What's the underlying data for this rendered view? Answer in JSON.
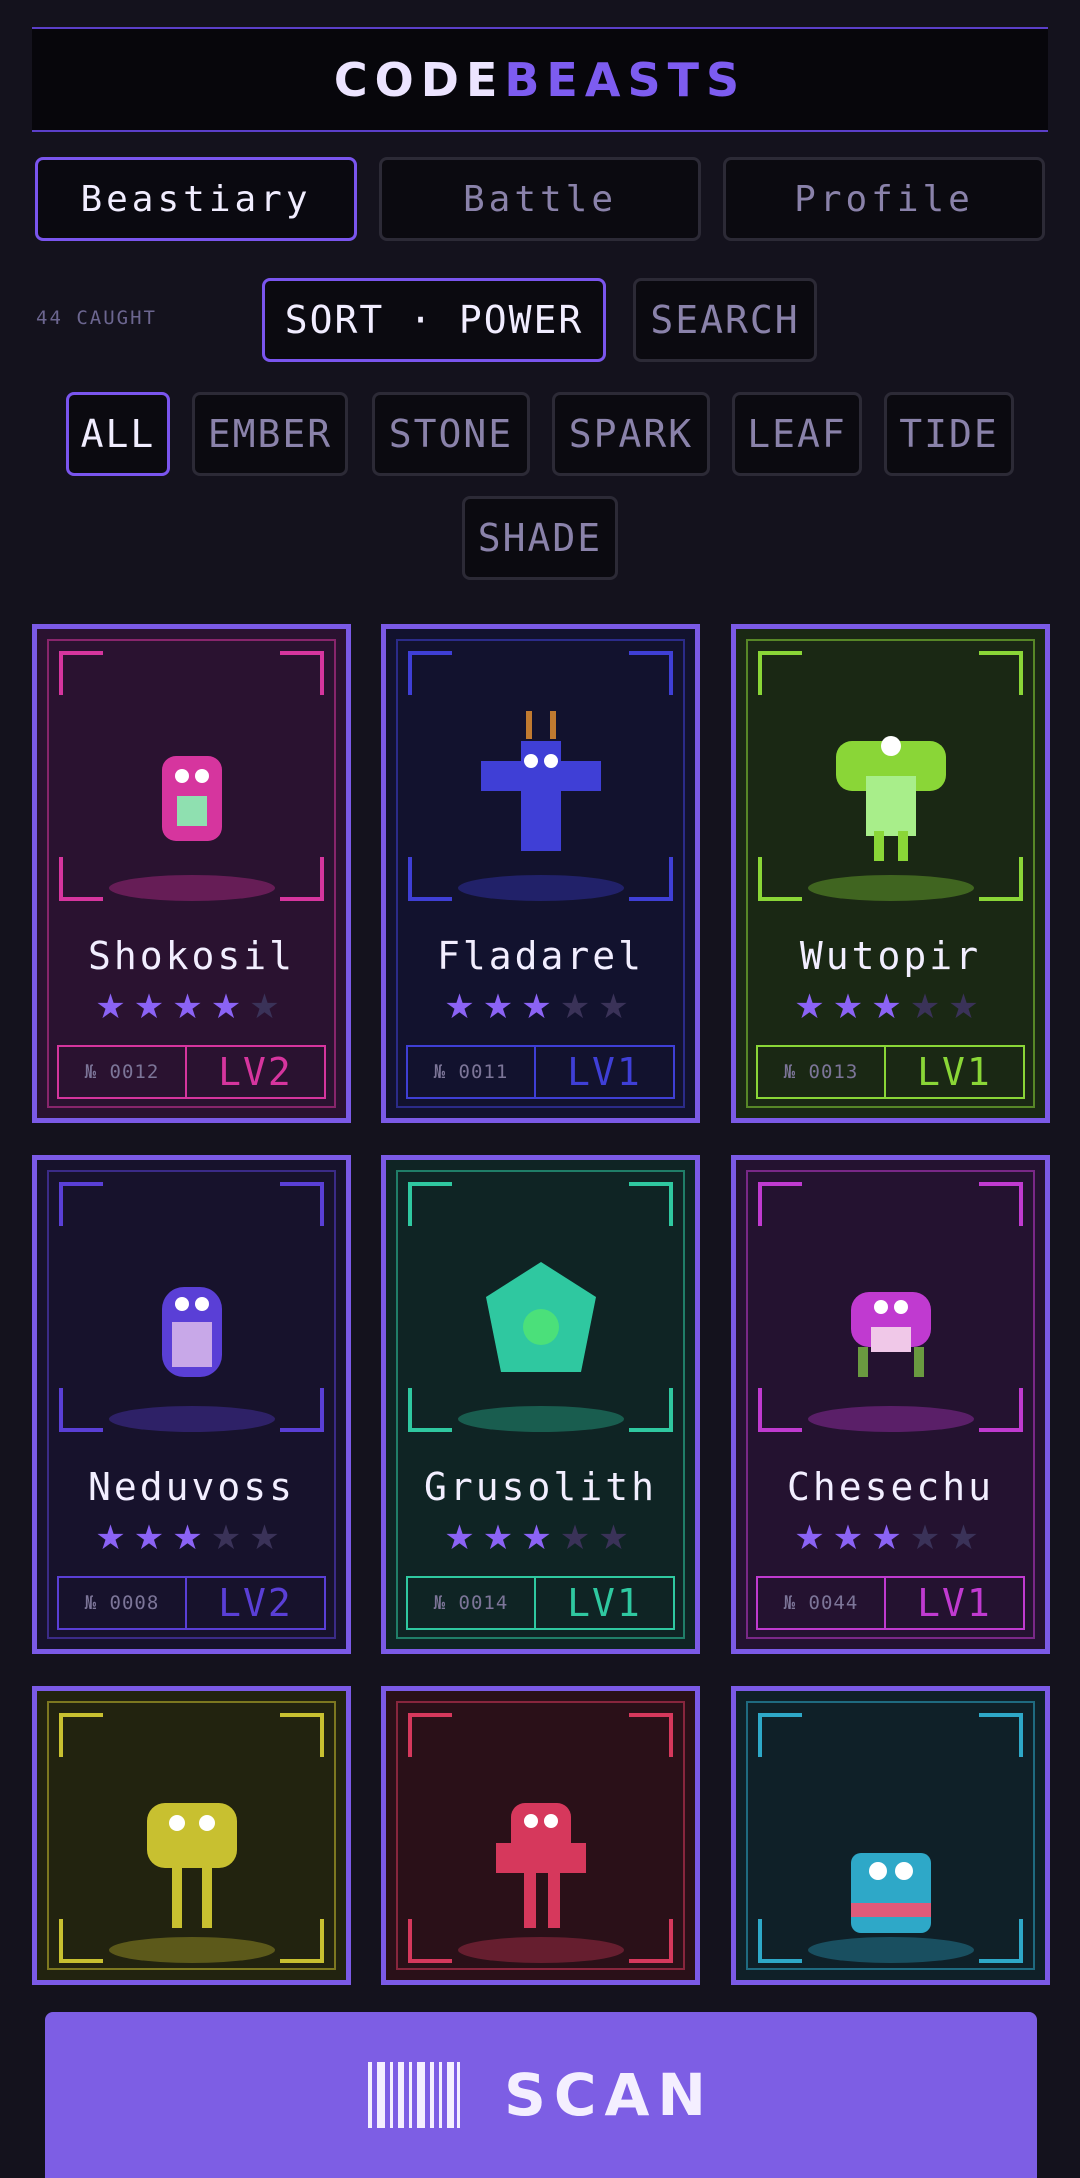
{
  "app": {
    "title_part1": "CODE",
    "title_part2": "BEASTS"
  },
  "tabs": [
    {
      "label": "Beastiary",
      "active": true
    },
    {
      "label": "Battle",
      "active": false
    },
    {
      "label": "Profile",
      "active": false
    }
  ],
  "toolbar": {
    "caught": "44 CAUGHT",
    "sort_label": "SORT · POWER",
    "search_label": "SEARCH"
  },
  "filters": [
    "ALL",
    "EMBER",
    "STONE",
    "SPARK",
    "LEAF",
    "TIDE",
    "SHADE"
  ],
  "active_filter": "ALL",
  "beasts": [
    {
      "name": "Shokosil",
      "number": "№ 0012",
      "level": "LV2",
      "stars": 4,
      "accent": "#d6359e",
      "bg": "#2a1230",
      "sprite": "pink-ghost-icon"
    },
    {
      "name": "Fladarel",
      "number": "№ 0011",
      "level": "LV1",
      "stars": 3,
      "accent": "#3f3fd6",
      "bg": "#12122e",
      "sprite": "blue-bug-icon"
    },
    {
      "name": "Wutopir",
      "number": "№ 0013",
      "level": "LV1",
      "stars": 3,
      "accent": "#8ad637",
      "bg": "#1a2814",
      "sprite": "green-plant-icon"
    },
    {
      "name": "Neduvoss",
      "number": "№ 0008",
      "level": "LV2",
      "stars": 3,
      "accent": "#5a3fd6",
      "bg": "#17122c",
      "sprite": "purple-blob-icon"
    },
    {
      "name": "Grusolith",
      "number": "№ 0014",
      "level": "LV1",
      "stars": 3,
      "accent": "#2fc8a0",
      "bg": "#0f2424",
      "sprite": "teal-rock-icon"
    },
    {
      "name": "Chesechu",
      "number": "№ 0044",
      "level": "LV1",
      "stars": 3,
      "accent": "#c03ad0",
      "bg": "#241230",
      "sprite": "magenta-crab-icon"
    },
    {
      "name": "",
      "number": "",
      "level": "",
      "stars": 0,
      "accent": "#c8c030",
      "bg": "#22230f",
      "sprite": "yellow-alien-icon"
    },
    {
      "name": "",
      "number": "",
      "level": "",
      "stars": 0,
      "accent": "#d6385c",
      "bg": "#2a1018",
      "sprite": "red-imp-icon"
    },
    {
      "name": "",
      "number": "",
      "level": "",
      "stars": 0,
      "accent": "#2ea8c8",
      "bg": "#0f2028",
      "sprite": "cyan-box-icon"
    }
  ],
  "scan": {
    "label": "SCAN",
    "icon": "barcode-icon"
  }
}
